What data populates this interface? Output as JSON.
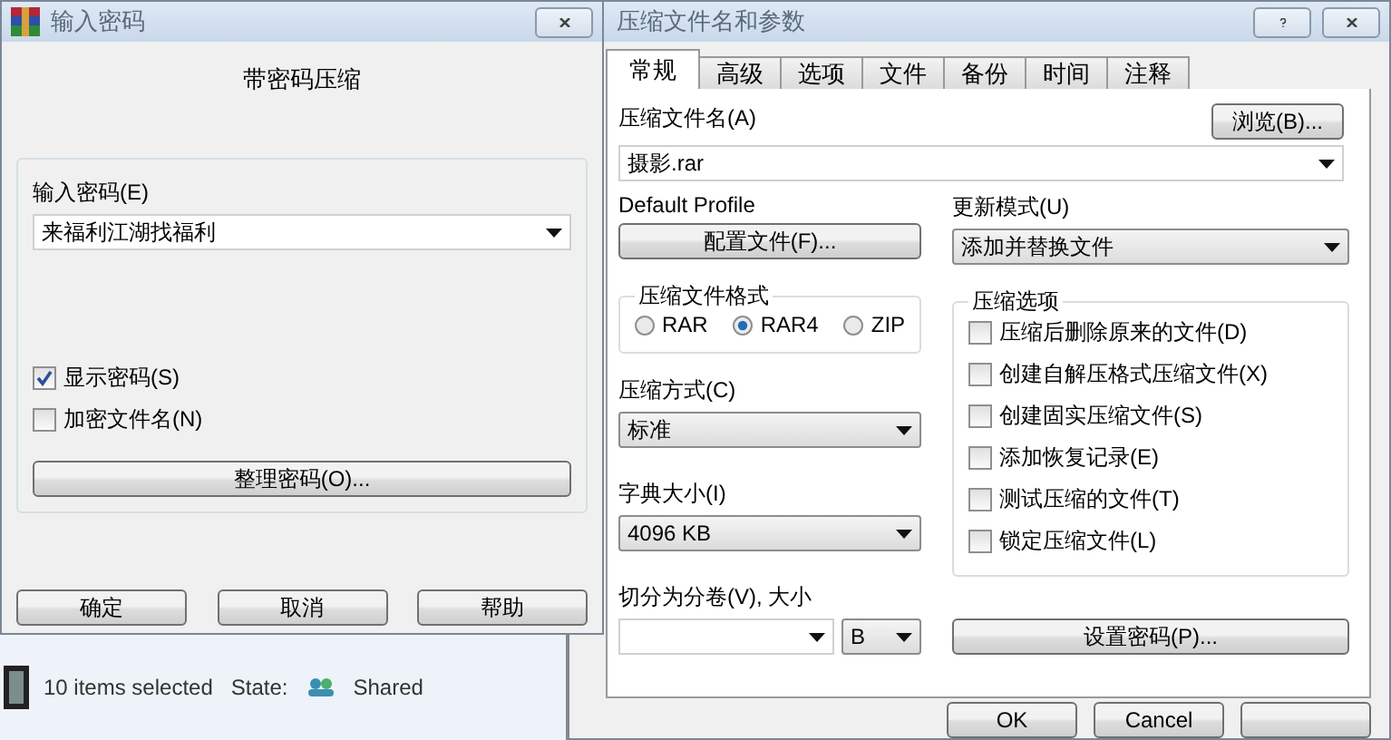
{
  "background_window": {
    "status": [
      {
        "text": "10 items selected"
      },
      {
        "text": "State:"
      },
      {
        "text": "Shared"
      }
    ]
  },
  "password_dialog": {
    "title": "输入密码",
    "heading": "带密码压缩",
    "password_label": "输入密码(E)",
    "password_value": "来福利江湖找福利",
    "checkboxes": [
      {
        "label": "显示密码(S)",
        "checked": true
      },
      {
        "label": "加密文件名(N)",
        "checked": false
      }
    ],
    "organize_button": "整理密码(O)...",
    "buttons": [
      "确定",
      "取消",
      "帮助"
    ]
  },
  "archive_dialog": {
    "title": "压缩文件名和参数",
    "tabs": [
      {
        "label": "常规",
        "selected": true
      },
      {
        "label": "高级",
        "selected": false
      },
      {
        "label": "选项",
        "selected": false
      },
      {
        "label": "文件",
        "selected": false
      },
      {
        "label": "备份",
        "selected": false
      },
      {
        "label": "时间",
        "selected": false
      },
      {
        "label": "注释",
        "selected": false
      }
    ],
    "archive_name_label": "压缩文件名(A)",
    "browse_button": "浏览(B)...",
    "archive_name_value": "摄影.rar",
    "profile_label": "Default Profile",
    "profile_button": "配置文件(F)...",
    "update_mode_label": "更新模式(U)",
    "update_mode_value": "添加并替换文件",
    "format_group": "压缩文件格式",
    "formats": [
      {
        "label": "RAR",
        "selected": false
      },
      {
        "label": "RAR4",
        "selected": true
      },
      {
        "label": "ZIP",
        "selected": false
      }
    ],
    "method_label": "压缩方式(C)",
    "method_value": "标准",
    "dict_label": "字典大小(I)",
    "dict_value": "4096 KB",
    "split_label": "切分为分卷(V), 大小",
    "split_unit": "B",
    "options_group": "压缩选项",
    "options": [
      {
        "label": "压缩后删除原来的文件(D)",
        "checked": false
      },
      {
        "label": "创建自解压格式压缩文件(X)",
        "checked": false
      },
      {
        "label": "创建固实压缩文件(S)",
        "checked": false
      },
      {
        "label": "添加恢复记录(E)",
        "checked": false
      },
      {
        "label": "测试压缩的文件(T)",
        "checked": false
      },
      {
        "label": "锁定压缩文件(L)",
        "checked": false
      }
    ],
    "set_password_button": "设置密码(P)...",
    "buttons": [
      "OK",
      "Cancel"
    ]
  }
}
